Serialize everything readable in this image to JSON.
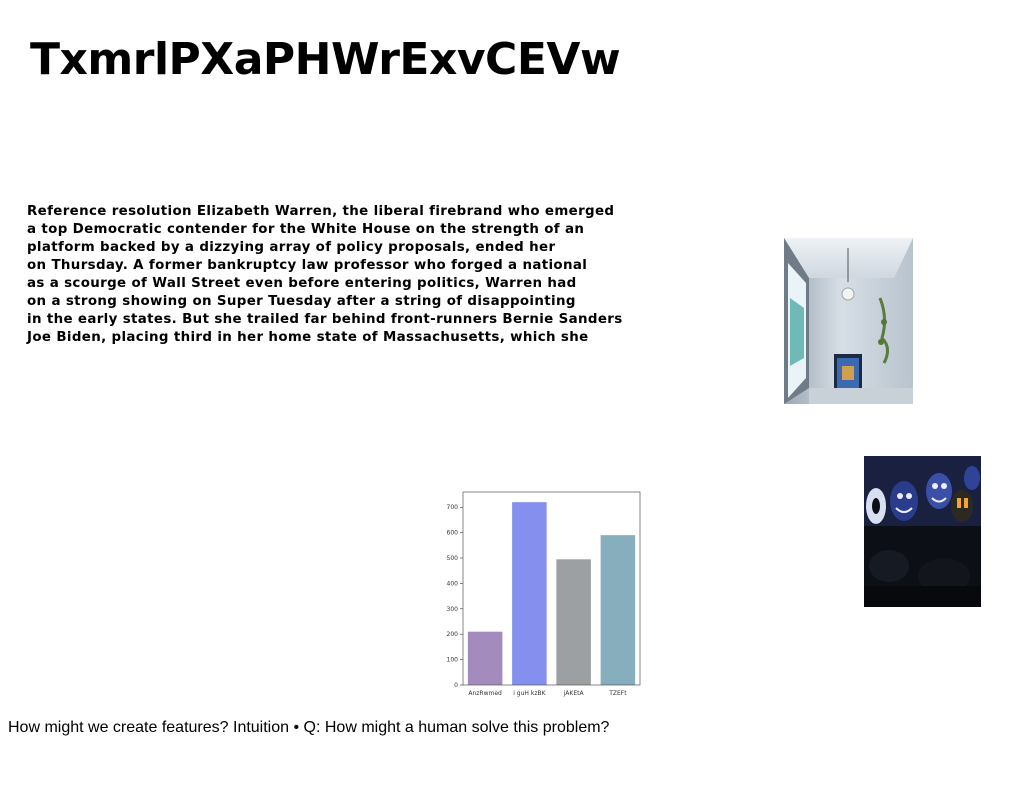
{
  "document": {
    "title": "TxmrlPXaPHWrExvCEVw",
    "paragraph_lines": [
      "Reference resolution Elizabeth Warren, the liberal firebrand who emerged",
      "a top Democratic contender for the White House on the strength of an",
      "platform backed by a dizzying array of policy proposals, ended her",
      "on Thursday. A former bankruptcy law professor who forged a national",
      "as a scourge of Wall Street even before entering politics, Warren had",
      "on a strong showing on Super Tuesday after a string of disappointing",
      "in the early states. But she trailed far behind front-runners Bernie Sanders",
      "Joe Biden, placing third in her home state of Massachusetts, which she"
    ],
    "caption": "How might we create features? Intuition • Q: How might a human solve this problem?"
  },
  "chart_data": {
    "type": "bar",
    "categories": [
      "AnzRwmed",
      "i guH kzBK",
      "jAKEtA",
      "TZEFt"
    ],
    "values": [
      210,
      720,
      495,
      590
    ],
    "colors": [
      "#a48bbd",
      "#8590ee",
      "#9da0a2",
      "#86aebd"
    ],
    "yticks": [
      0,
      100,
      200,
      300,
      400,
      500,
      600,
      700
    ],
    "ylim": [
      0,
      760
    ],
    "grid": false
  }
}
